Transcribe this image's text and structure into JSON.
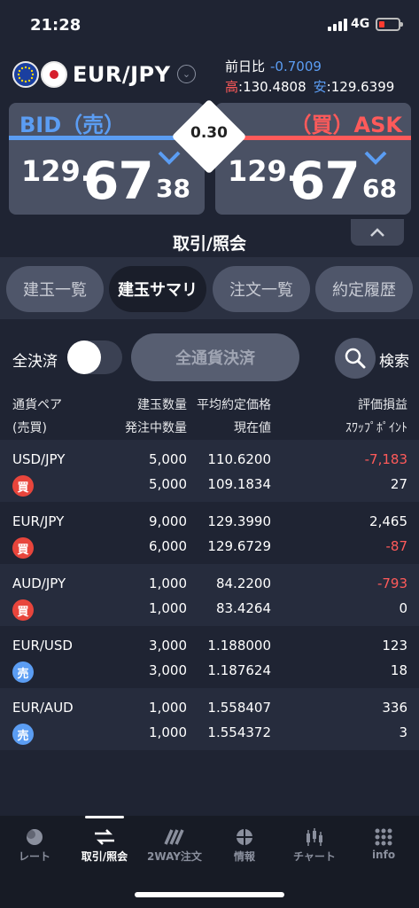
{
  "status": {
    "time": "21:28",
    "network": "4G"
  },
  "header": {
    "pair": "EUR/JPY",
    "prev_label": "前日比",
    "prev_value": "-0.7009",
    "high_label": "高",
    "high_value": ":130.4808",
    "low_label": "安",
    "low_value": ":129.6399"
  },
  "quote": {
    "bid_label": "BID（売）",
    "ask_label": "（買）ASK",
    "bid": {
      "main": "129.",
      "big": "67",
      "small": "38"
    },
    "ask": {
      "main": "129.",
      "big": "67",
      "small": "68"
    },
    "spread": "0.30"
  },
  "section_title": "取引/照会",
  "tabs": [
    {
      "label": "建玉一覧",
      "active": false
    },
    {
      "label": "建玉サマリ",
      "active": true
    },
    {
      "label": "注文一覧",
      "active": false
    },
    {
      "label": "約定履歴",
      "active": false
    }
  ],
  "controls": {
    "close_all_label": "全決済",
    "settle_all_label": "全通貨決済",
    "search_label": "検索"
  },
  "table": {
    "headers": {
      "pair": "通貨ペア",
      "side": "(売買)",
      "position_qty": "建玉数量",
      "order_qty": "発注中数量",
      "avg_price": "平均約定価格",
      "current": "現在値",
      "pnl": "評価損益",
      "swap": "ｽﾜｯﾌﾟﾎﾟｲﾝﾄ"
    },
    "rows": [
      {
        "pair": "USD/JPY",
        "side": "買",
        "position_qty": "5,000",
        "order_qty": "5,000",
        "avg_price": "110.6200",
        "current": "109.1834",
        "pnl": "-7,183",
        "swap": "27"
      },
      {
        "pair": "EUR/JPY",
        "side": "買",
        "position_qty": "9,000",
        "order_qty": "6,000",
        "avg_price": "129.3990",
        "current": "129.6729",
        "pnl": "2,465",
        "swap": "-87"
      },
      {
        "pair": "AUD/JPY",
        "side": "買",
        "position_qty": "1,000",
        "order_qty": "1,000",
        "avg_price": "84.2200",
        "current": "83.4264",
        "pnl": "-793",
        "swap": "0"
      },
      {
        "pair": "EUR/USD",
        "side": "売",
        "position_qty": "3,000",
        "order_qty": "3,000",
        "avg_price": "1.188000",
        "current": "1.187624",
        "pnl": "123",
        "swap": "18"
      },
      {
        "pair": "EUR/AUD",
        "side": "売",
        "position_qty": "1,000",
        "order_qty": "1,000",
        "avg_price": "1.558407",
        "current": "1.554372",
        "pnl": "336",
        "swap": "3"
      }
    ]
  },
  "colors": {
    "buy": "#e8453c",
    "sell": "#5b9df3",
    "negative": "#ff5a5a"
  },
  "nav": [
    {
      "label": "レート",
      "icon": "rate-icon",
      "active": false
    },
    {
      "label": "取引/照会",
      "icon": "trade-icon",
      "active": true
    },
    {
      "label": "2WAY注文",
      "icon": "twoway-icon",
      "active": false
    },
    {
      "label": "情報",
      "icon": "info-globe-icon",
      "active": false
    },
    {
      "label": "チャート",
      "icon": "chart-icon",
      "active": false
    },
    {
      "label": "info",
      "icon": "grid-icon",
      "active": false
    }
  ]
}
